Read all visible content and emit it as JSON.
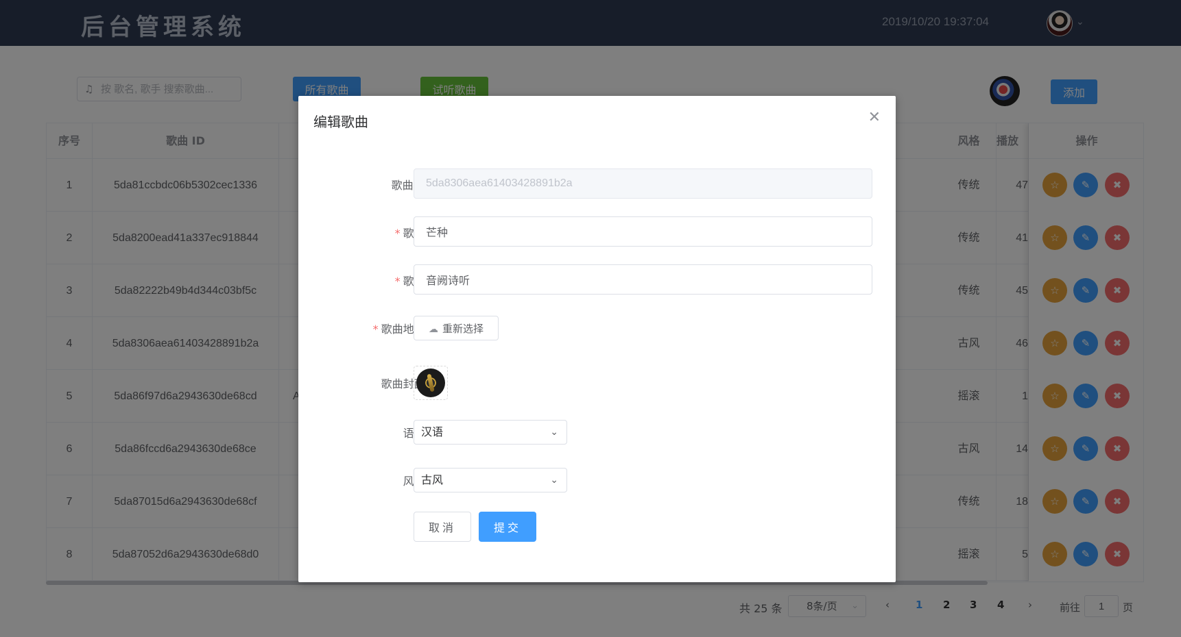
{
  "header": {
    "title": "后台管理系统",
    "datetime": "2019/10/20 19:37:04",
    "user_icon": "user-avatar",
    "caret_icon": "chevron-down-icon"
  },
  "toolbar": {
    "search_placeholder": "按 歌名, 歌手 搜索歌曲...",
    "all_songs_label": "所有歌曲",
    "trial_songs_label": "试听歌曲",
    "add_label": "添加"
  },
  "table": {
    "columns": [
      "序号",
      "歌曲 ID",
      "风格",
      "播放次",
      "操作"
    ],
    "rows": [
      {
        "index": "1",
        "id": "5da81ccbdc06b5302cec1336",
        "mid": "",
        "style": "传统",
        "plays": "47"
      },
      {
        "index": "2",
        "id": "5da8200ead41a337ec918844",
        "mid": "",
        "style": "传统",
        "plays": "41"
      },
      {
        "index": "3",
        "id": "5da82222b49b4d344c03bf5c",
        "mid": "",
        "style": "传统",
        "plays": "45"
      },
      {
        "index": "4",
        "id": "5da8306aea61403428891b2a",
        "mid": "",
        "style": "古风",
        "plays": "46"
      },
      {
        "index": "5",
        "id": "5da86f97d6a2943630de68cd",
        "mid": "A",
        "style": "摇滚",
        "plays": "1"
      },
      {
        "index": "6",
        "id": "5da86fccd6a2943630de68ce",
        "mid": "",
        "style": "古风",
        "plays": "14"
      },
      {
        "index": "7",
        "id": "5da87015d6a2943630de68cf",
        "mid": "",
        "style": "传统",
        "plays": "18"
      },
      {
        "index": "8",
        "id": "5da87052d6a2943630de68d0",
        "mid": "",
        "style": "摇滚",
        "plays": "5"
      }
    ]
  },
  "pagination": {
    "total": "共 25 条",
    "page_size": "8条/页",
    "pages": [
      "1",
      "2",
      "3",
      "4"
    ],
    "current": "1",
    "goto_label": "前往",
    "goto_value": "1",
    "page_suffix": "页"
  },
  "dialog": {
    "title": "编辑歌曲",
    "close_icon": "close-icon",
    "fields": {
      "song_id_label": "歌曲ID:",
      "song_id_value": "5da8306aea61403428891b2a",
      "song_label": "歌曲:",
      "song_value": "芒种",
      "singer_label": "歌手:",
      "singer_value": "音阙诗听",
      "url_label": "歌曲地址:",
      "reselect_label": "重新选择",
      "cover_label": "歌曲封面:",
      "language_label": "语种:",
      "language_value": "汉语",
      "style_label": "风格:",
      "style_value": "古风"
    },
    "cancel_label": "取消",
    "submit_label": "提交"
  },
  "colors": {
    "primary": "#409eff",
    "success": "#67c23a",
    "warning": "#e6a23c",
    "danger": "#f56c6c",
    "header_bg": "#2f3b52"
  }
}
